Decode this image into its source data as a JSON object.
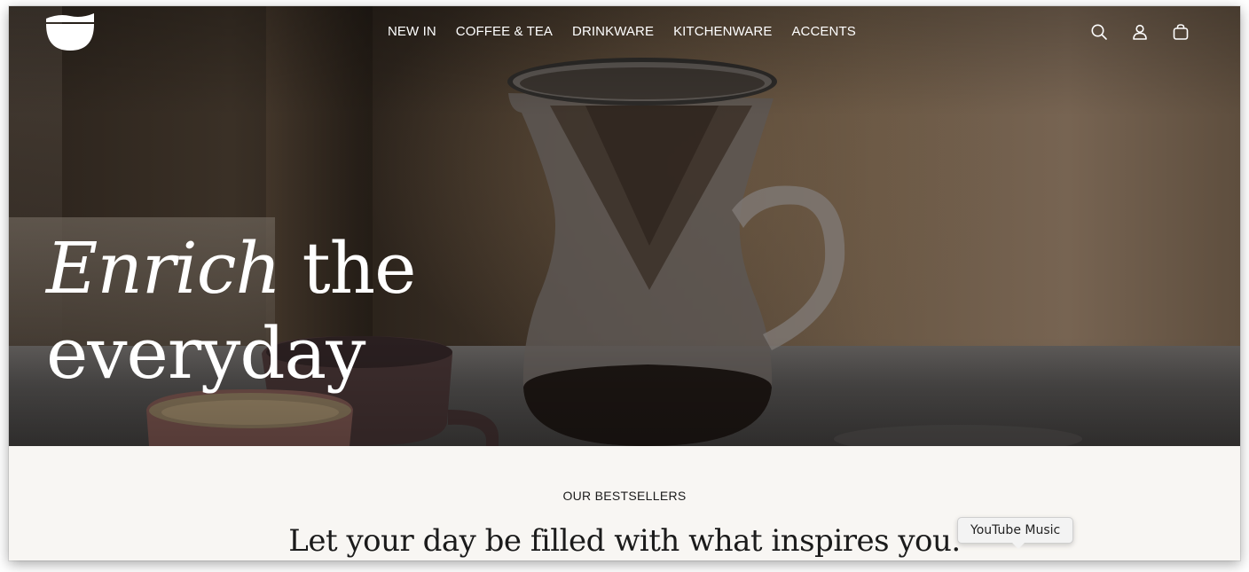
{
  "nav": {
    "links": [
      "NEW IN",
      "COFFEE & TEA",
      "DRINKWARE",
      "KITCHENWARE",
      "ACCENTS"
    ],
    "icons": [
      "search-icon",
      "account-icon",
      "cart-icon"
    ]
  },
  "hero": {
    "headline_italic": "Enrich",
    "headline_rest": " the",
    "headline_line2": "everyday"
  },
  "bestsellers": {
    "eyebrow": "OUR BESTSELLERS",
    "title": "Let your day be filled with what inspires you."
  },
  "tooltip": {
    "text": "YouTube Music"
  },
  "colors": {
    "hero_text": "#ffffff",
    "section_bg": "#f8f6f3",
    "section_text": "#1b1b1b"
  }
}
